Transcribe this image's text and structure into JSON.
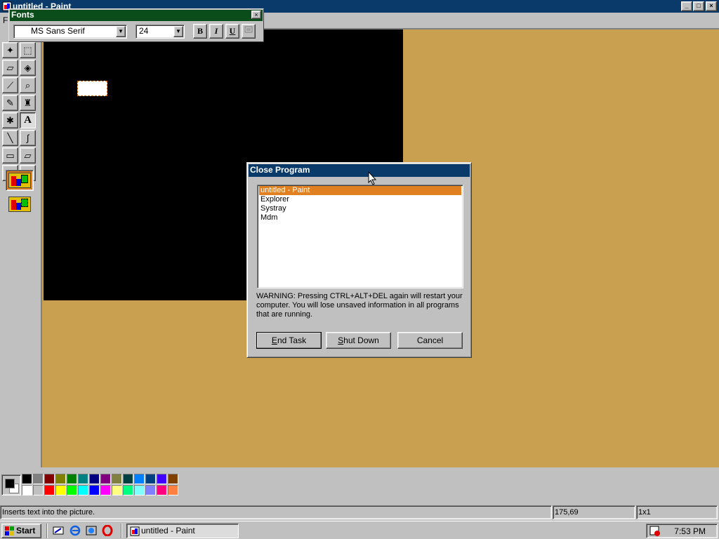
{
  "window": {
    "title": "untitled - Paint",
    "min": "_",
    "max": "□",
    "close": "×"
  },
  "menu": [
    "F"
  ],
  "fonts_bar": {
    "title": "Fonts",
    "font_name": "MS Sans Serif",
    "font_size": "24",
    "bold": "B",
    "italic": "I",
    "underline": "U",
    "close": "×"
  },
  "tools": [
    {
      "name": "free-form-select",
      "glyph": "✦"
    },
    {
      "name": "select",
      "glyph": "⬚"
    },
    {
      "name": "eraser",
      "glyph": "▱"
    },
    {
      "name": "fill",
      "glyph": "◈"
    },
    {
      "name": "pick-color",
      "glyph": "⟋"
    },
    {
      "name": "magnifier",
      "glyph": "⌕"
    },
    {
      "name": "pencil",
      "glyph": "✎"
    },
    {
      "name": "brush",
      "glyph": "♜"
    },
    {
      "name": "airbrush",
      "glyph": "✱"
    },
    {
      "name": "text",
      "glyph": "A"
    },
    {
      "name": "line",
      "glyph": "╲"
    },
    {
      "name": "curve",
      "glyph": "∫"
    },
    {
      "name": "rectangle",
      "glyph": "▭"
    },
    {
      "name": "polygon",
      "glyph": "▱"
    },
    {
      "name": "ellipse",
      "glyph": "⬭"
    },
    {
      "name": "rounded-rectangle",
      "glyph": "▢"
    }
  ],
  "dialog": {
    "title": "Close Program",
    "tasks": [
      "untitled - Paint",
      "Explorer",
      "Systray",
      "Mdm"
    ],
    "selected_index": 0,
    "warning": "WARNING: Pressing CTRL+ALT+DEL again will restart your computer. You will lose unsaved information in all programs that are running.",
    "end_task": "End Task",
    "shut_down": "Shut Down",
    "cancel": "Cancel"
  },
  "palette": {
    "foreground": "#000000",
    "background": "#ffffff",
    "top_row": [
      "#000000",
      "#808080",
      "#800000",
      "#808000",
      "#008000",
      "#008080",
      "#000080",
      "#800080",
      "#808040",
      "#004040",
      "#0080ff",
      "#004080",
      "#4000ff",
      "#804000"
    ],
    "bottom_row": [
      "#ffffff",
      "#c0c0c0",
      "#ff0000",
      "#ffff00",
      "#00ff00",
      "#00ffff",
      "#0000ff",
      "#ff00ff",
      "#ffff80",
      "#00ff80",
      "#80ffff",
      "#8080ff",
      "#ff0080",
      "#ff8040"
    ]
  },
  "status": {
    "hint": "Inserts text into the picture.",
    "coords": "175,69",
    "size": "1x1"
  },
  "taskbar": {
    "start": "Start",
    "task": "untitled - Paint",
    "clock": "7:53 PM"
  },
  "colors": {
    "title_active": "#0a3a6a",
    "fonts_title": "#0a4d1a",
    "workspace": "#c8a050",
    "selection": "#e08020"
  }
}
